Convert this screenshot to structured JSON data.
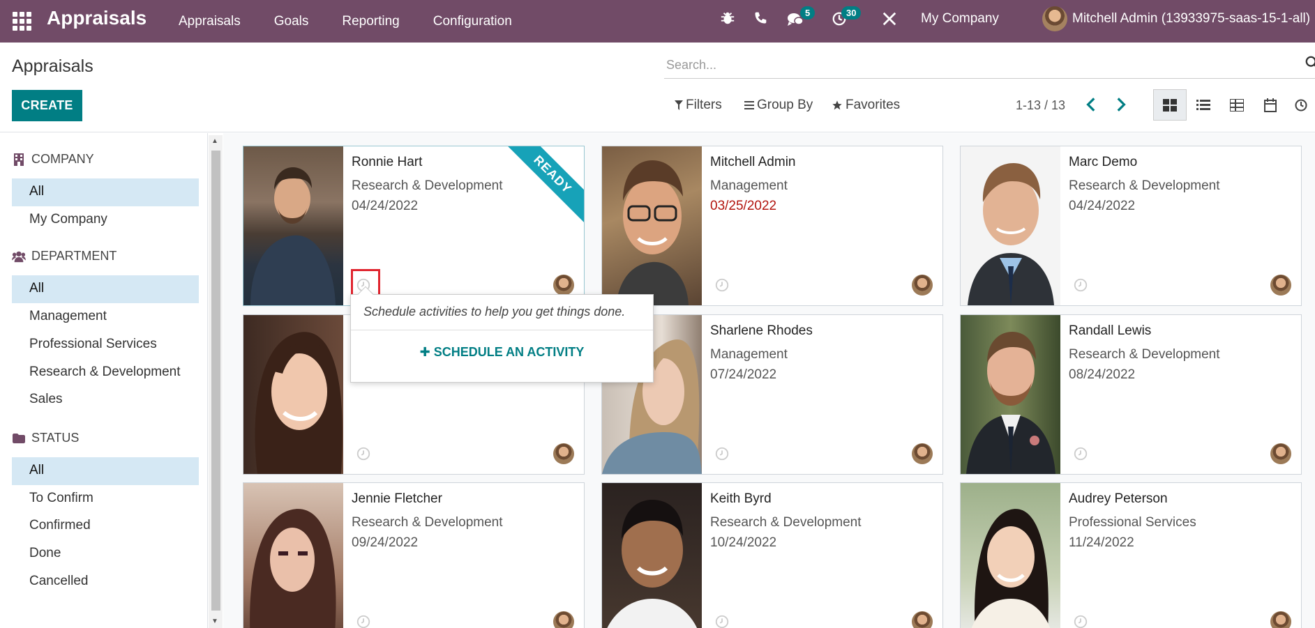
{
  "app": {
    "title": "Appraisals"
  },
  "menu": [
    "Appraisals",
    "Goals",
    "Reporting",
    "Configuration"
  ],
  "systray": {
    "messages_count": "5",
    "activities_count": "30",
    "company": "My Company",
    "user": "Mitchell Admin (13933975-saas-15-1-all)"
  },
  "control": {
    "page_title": "Appraisals",
    "create_label": "CREATE",
    "search_placeholder": "Search...",
    "filters_label": "Filters",
    "groupby_label": "Group By",
    "favorites_label": "Favorites",
    "pager": "1-13 / 13"
  },
  "sidebar": {
    "company": {
      "title": "COMPANY",
      "items": [
        "All",
        "My Company"
      ]
    },
    "department": {
      "title": "DEPARTMENT",
      "items": [
        "All",
        "Management",
        "Professional Services",
        "Research & Development",
        "Sales"
      ]
    },
    "status": {
      "title": "STATUS",
      "items": [
        "All",
        "To Confirm",
        "Confirmed",
        "Done",
        "Cancelled"
      ]
    }
  },
  "cards": [
    {
      "name": "Ronnie Hart",
      "dept": "Research & Development",
      "date": "04/24/2022",
      "ribbon": "READY"
    },
    {
      "name": "Mitchell Admin",
      "dept": "Management",
      "date": "03/25/2022",
      "late": true
    },
    {
      "name": "Marc Demo",
      "dept": "Research & Development",
      "date": "04/24/2022"
    },
    {
      "name": "",
      "dept": "",
      "date": ""
    },
    {
      "name": "Sharlene Rhodes",
      "dept": "Management",
      "date": "07/24/2022"
    },
    {
      "name": "Randall Lewis",
      "dept": "Research & Development",
      "date": "08/24/2022"
    },
    {
      "name": "Jennie Fletcher",
      "dept": "Research & Development",
      "date": "09/24/2022"
    },
    {
      "name": "Keith Byrd",
      "dept": "Research & Development",
      "date": "10/24/2022"
    },
    {
      "name": "Audrey Peterson",
      "dept": "Professional Services",
      "date": "11/24/2022"
    }
  ],
  "popover": {
    "text": "Schedule activities to help you get things done.",
    "button": "SCHEDULE AN ACTIVITY"
  },
  "colors": {
    "nav": "#714b67",
    "accent": "#017e84",
    "late": "#b2140e",
    "ribbon": "#17a2b8",
    "highlight": "#e0242e"
  }
}
